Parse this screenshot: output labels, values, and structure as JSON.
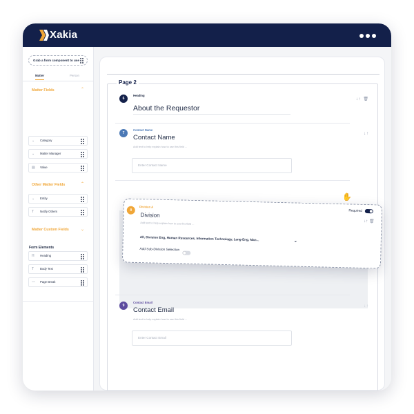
{
  "app": {
    "title": "Xakia"
  },
  "sidebar": {
    "grab_text": "Grab a form component to use",
    "tabs": [
      "Matter",
      "Person"
    ],
    "sections": [
      {
        "title": "Matter Fields",
        "items": [
          "Category",
          "Matter Manager",
          "Value"
        ]
      },
      {
        "title": "Other Matter Fields",
        "items": [
          "Entity",
          "Notify Others"
        ]
      },
      {
        "title": "Matter Custom Fields",
        "items": []
      }
    ],
    "form_elements": {
      "title": "Form Elements",
      "items": [
        "Heading",
        "Body Text",
        "Page Break"
      ]
    }
  },
  "form": {
    "page_title": "Page 2",
    "questions": [
      {
        "number": "6",
        "type": "Heading",
        "title": "About the Requestor",
        "color": "#13204a"
      },
      {
        "number": "7",
        "type": "Contact Name",
        "title": "Contact Name",
        "help": "Add text to help explain how to use this field ...",
        "placeholder": "Enter Contact Name",
        "color": "#4b79b6"
      },
      {
        "number": "8",
        "type": "Division A",
        "title": "Division",
        "help": "Add text to help explain how to use this field ...",
        "required_label": "Required",
        "selected_divisions": "All, Division Eng, Human Resources, Information Technology, Lang-Eng, Man...",
        "sub_division_label": "Add Sub-Division Selection",
        "color": "#f0a637"
      },
      {
        "number": "9",
        "type": "Contact Email",
        "title": "Contact Email",
        "help": "Add text to help explain how to use this field ...",
        "placeholder": "Enter Contact Email",
        "color": "#5c4b9e"
      }
    ]
  },
  "icons": {
    "sort": "↓↑",
    "delete": "trash-icon",
    "drag_handle": "grip-icon",
    "cursor": "grab-hand-icon"
  },
  "colors": {
    "navy": "#13204a",
    "accent": "#f0a637"
  }
}
